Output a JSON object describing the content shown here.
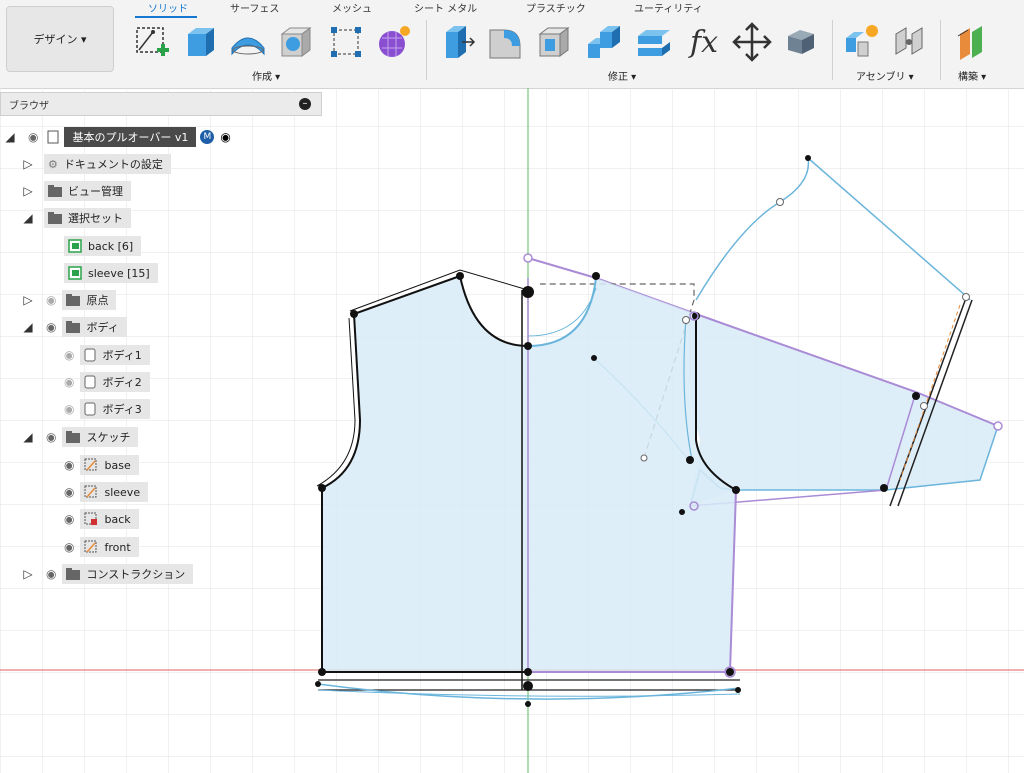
{
  "toolbar": {
    "workspace_label": "デザイン ▾",
    "tabs": [
      "ソリッド",
      "サーフェス",
      "メッシュ",
      "シート メタル",
      "プラスチック",
      "ユーティリティ"
    ],
    "groups": {
      "create": "作成 ▾",
      "modify": "修正 ▾",
      "assemble": "アセンブリ ▾",
      "construct": "構築 ▾"
    },
    "fx_label": "fx"
  },
  "browser": {
    "title": "ブラウザ",
    "root": "基本のプルオーバー v1",
    "root_badge": "M",
    "items": {
      "doc_settings": "ドキュメントの設定",
      "view_mgmt": "ビュー管理",
      "selection_sets": "選択セット",
      "set_back": "back [6]",
      "set_sleeve": "sleeve [15]",
      "origin": "原点",
      "bodies": "ボディ",
      "body1": "ボディ1",
      "body2": "ボディ2",
      "body3": "ボディ3",
      "sketches": "スケッチ",
      "sk_base": "base",
      "sk_sleeve": "sleeve",
      "sk_back": "back",
      "sk_front": "front",
      "construction": "コンストラクション"
    }
  },
  "colors": {
    "accent": "#1677d2",
    "sketch_blue": "#6bb5dc",
    "profile_fill": "#d8ebf7",
    "sleeve_purple": "#a98bd6",
    "axis_green": "#78c878",
    "axis_red": "#e88080"
  }
}
